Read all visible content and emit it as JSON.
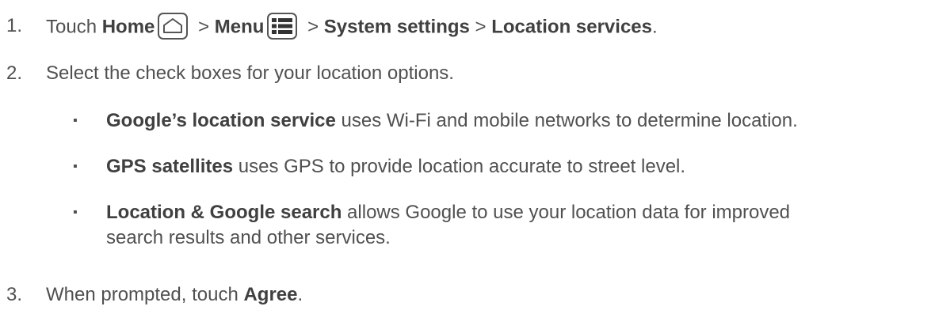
{
  "steps": [
    {
      "number": "1.",
      "prefix": "Touch ",
      "home_label": "Home",
      "home_icon": "home-outline-icon",
      "sep1": " > ",
      "menu_label": "Menu",
      "menu_icon": "menu-list-icon",
      "sep2": " > ",
      "system_settings": "System settings",
      "sep3": " > ",
      "location_services": "Location services",
      "end": "."
    },
    {
      "number": "2.",
      "text": "Select the check boxes for your location options."
    },
    {
      "number": "3.",
      "prefix": "When prompted, touch ",
      "agree": "Agree",
      "end": "."
    }
  ],
  "bullets": [
    {
      "symbol": "▪",
      "bold": "Google’s location service",
      "rest": " uses Wi-Fi and mobile networks to determine location."
    },
    {
      "symbol": "▪",
      "bold": "GPS satellites",
      "rest": " uses GPS to provide location accurate to street level."
    },
    {
      "symbol": "▪",
      "bold": "Location & Google search",
      "rest": " allows Google to use your location data for improved",
      "rest_line2": "search results and other services."
    }
  ]
}
